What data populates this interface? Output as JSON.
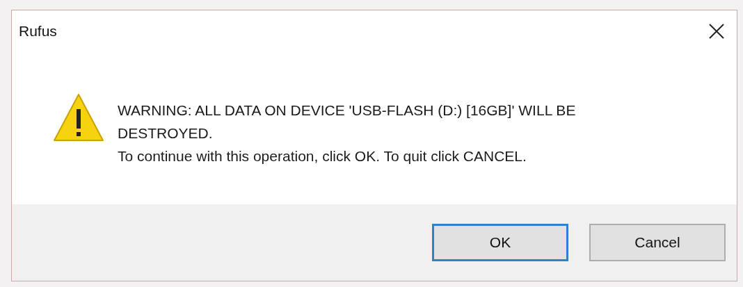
{
  "window": {
    "title": "Rufus"
  },
  "message": {
    "lines": [
      "WARNING: ALL DATA ON DEVICE 'USB-FLASH (D:) [16GB]' WILL BE DESTROYED.",
      "To continue with this operation, click OK. To quit click CANCEL."
    ]
  },
  "buttons": [
    {
      "label": "OK",
      "focused": true
    },
    {
      "label": "Cancel",
      "focused": false
    }
  ]
}
